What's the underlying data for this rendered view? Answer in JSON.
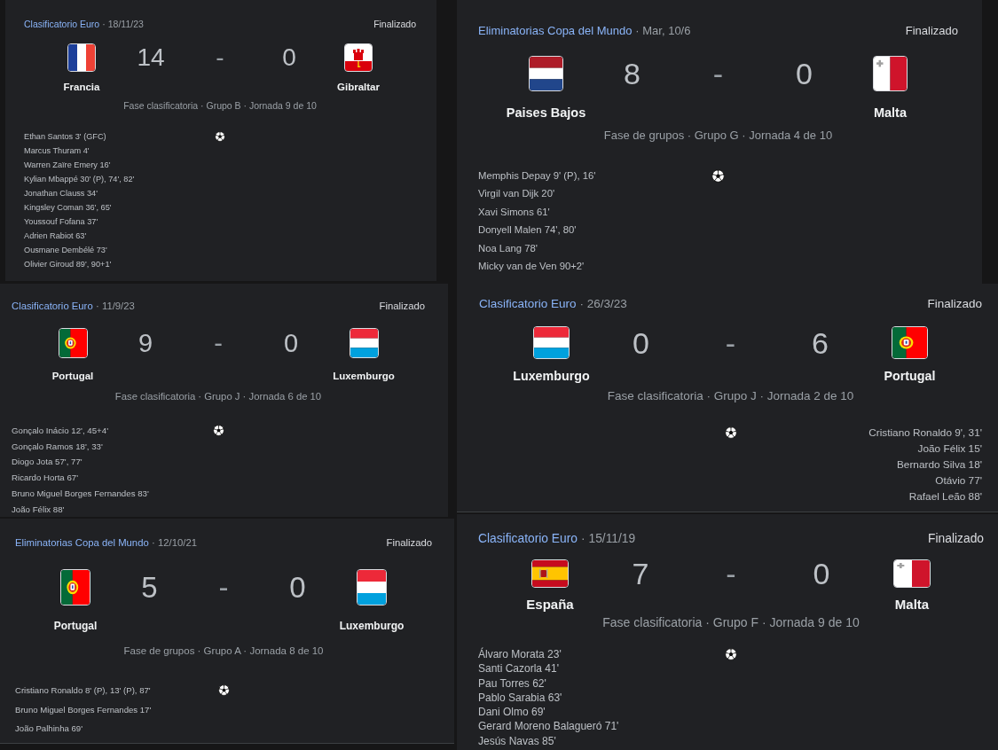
{
  "left_column": {
    "matches": [
      {
        "competition": "Clasificatorio Euro",
        "date": "· 18/11/23",
        "status": "Finalizado",
        "home": {
          "name": "Francia",
          "kind": "france",
          "score": "14"
        },
        "separator": "-",
        "away": {
          "name": "Gibraltar",
          "kind": "gibraltar",
          "score": "0"
        },
        "stage": "Fase clasificatoria · Grupo B · Jornada 9 de 10",
        "home_scorers": [
          "Ethan Santos 3' (GFC)",
          "Marcus Thuram 4'",
          "Warren Zaïre Emery 16'",
          "Kylian Mbappé 30' (P), 74', 82'",
          "Jonathan Clauss 34'",
          "Kingsley Coman 36', 65'",
          "Youssouf Fofana 37'",
          "Adrien Rabiot 63'",
          "Ousmane Dembélé 73'",
          "Olivier Giroud 89', 90+1'"
        ]
      },
      {
        "competition": "Clasificatorio Euro",
        "date": "· 11/9/23",
        "status": "Finalizado",
        "home": {
          "name": "Portugal",
          "kind": "portugal",
          "score": "9"
        },
        "separator": "-",
        "away": {
          "name": "Luxemburgo",
          "kind": "luxembourg",
          "score": "0"
        },
        "stage": "Fase clasificatoria · Grupo J · Jornada 6 de 10",
        "home_scorers": [
          "Gonçalo Inácio 12', 45+4'",
          "Gonçalo Ramos 18', 33'",
          "Diogo Jota 57', 77'",
          "Ricardo Horta 67'",
          "Bruno Miguel Borges Fernandes 83'",
          "João Félix 88'"
        ]
      },
      {
        "competition": "Eliminatorias Copa del Mundo",
        "date": "· 12/10/21",
        "status": "Finalizado",
        "home": {
          "name": "Portugal",
          "kind": "portugal",
          "score": "5"
        },
        "separator": "-",
        "away": {
          "name": "Luxemburgo",
          "kind": "luxembourg",
          "score": "0"
        },
        "stage": "Fase de grupos · Grupo A · Jornada 8 de 10",
        "home_scorers": [
          "Cristiano Ronaldo 8' (P), 13' (P), 87'",
          "Bruno Miguel Borges Fernandes 17'",
          "João Palhinha 69'"
        ]
      }
    ]
  },
  "right_column": {
    "matches": [
      {
        "competition": "Eliminatorias Copa del Mundo",
        "date": "· Mar, 10/6",
        "status": "Finalizado",
        "home": {
          "name": "Paises Bajos",
          "kind": "netherlands",
          "score": "8"
        },
        "separator": "-",
        "away": {
          "name": "Malta",
          "kind": "malta",
          "score": "0"
        },
        "stage": "Fase de grupos · Grupo G · Jornada 4 de 10",
        "home_scorers": [
          "Memphis Depay 9' (P), 16'",
          "Virgil van Dijk 20'",
          "Xavi Simons 61'",
          "Donyell Malen 74', 80'",
          "Noa Lang 78'",
          "Micky van de Ven 90+2'"
        ]
      },
      {
        "competition": "Clasificatorio Euro",
        "date": "· 26/3/23",
        "status": "Finalizado",
        "home": {
          "name": "Luxemburgo",
          "kind": "luxembourg",
          "score": "0"
        },
        "separator": "-",
        "away": {
          "name": "Portugal",
          "kind": "portugal",
          "score": "6"
        },
        "stage": "Fase clasificatoria · Grupo J · Jornada 2 de 10",
        "away_scorers": [
          "Cristiano Ronaldo 9', 31'",
          "João Félix 15'",
          "Bernardo Silva 18'",
          "Otávio 77'",
          "Rafael Leão 88'"
        ]
      },
      {
        "competition": "Clasificatorio Euro",
        "date": "· 15/11/19",
        "status": "Finalizado",
        "home": {
          "name": "España",
          "kind": "spain",
          "score": "7"
        },
        "separator": "-",
        "away": {
          "name": "Malta",
          "kind": "malta",
          "score": "0"
        },
        "stage": "Fase clasificatoria · Grupo F · Jornada 9 de 10",
        "home_scorers": [
          "Álvaro Morata 23'",
          "Santi Cazorla 41'",
          "Pau Torres 62'",
          "Pablo Sarabia 63'",
          "Dani Olmo 69'",
          "Gerard Moreno Balagueró 71'",
          "Jesús Navas 85'"
        ]
      }
    ]
  }
}
